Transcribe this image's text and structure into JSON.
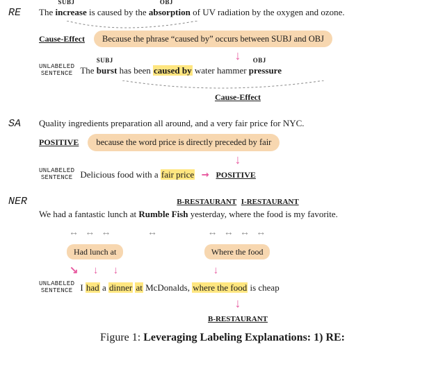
{
  "re": {
    "task": "RE",
    "sent": {
      "pre": "The ",
      "subj_role": "SUBJ",
      "subj": "increase",
      "mid1": " is caused by the ",
      "obj_role": "OBJ",
      "obj": "absorption",
      "post": " of UV radiation by the oxygen and ozone."
    },
    "label": "Cause-Effect",
    "explain": "Because the phrase “caused by” occurs between SUBJ and OBJ",
    "unlabeled_tag": "UNLABELED\nSENTENCE",
    "u": {
      "pre": "The ",
      "subj_role": "SUBJ",
      "subj": "burst",
      "mid1": " has been ",
      "hl": "caused by",
      "mid2": " water hammer ",
      "obj_role": "OBJ",
      "obj": "pressure"
    },
    "label2": "Cause-Effect"
  },
  "sa": {
    "task": "SA",
    "sent": "Quality ingredients preparation all around, and a very fair price for NYC.",
    "label": "POSITIVE",
    "explain": "because the word price is directly preceded by fair",
    "unlabeled_tag": "UNLABELED\nSENTENCE",
    "u": {
      "pre": "Delicious food with a ",
      "hl": "fair price",
      "arrow": "→",
      "label": "POSITIVE"
    }
  },
  "ner": {
    "task": "NER",
    "tags": {
      "b": "B-RESTAURANT",
      "i": "I-RESTAURANT"
    },
    "sent": {
      "pre": "We had a fantastic lunch at ",
      "ent1": "Rumble",
      "ent2": "Fish",
      "post": " yesterday, where the food is my favorite."
    },
    "expl1": "Had lunch at",
    "expl2": "Where the food",
    "unlabeled_tag": "UNLABELED\nSENTENCE",
    "u": {
      "p1": "I ",
      "h1": "had",
      "p2": " a ",
      "h2": "dinner",
      "p3": " ",
      "h3": "at",
      "p4": " McDonalds, ",
      "h4": "where the food",
      "p5": " is cheap"
    },
    "tag_out": "B-RESTAURANT"
  },
  "caption": {
    "pre": "Figure 1: ",
    "bold": "Leveraging Labeling Explanations: 1) RE:"
  }
}
